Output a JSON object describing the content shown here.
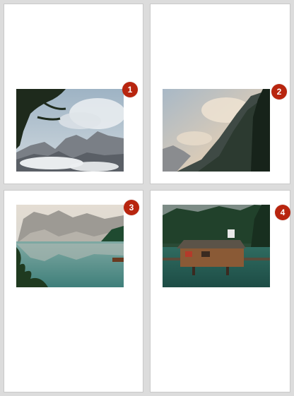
{
  "accent_color": "#b8250f",
  "pages": [
    {
      "badge": "1",
      "image": "misty-mountain-peaks-with-pine-branches"
    },
    {
      "badge": "2",
      "image": "mountain-ridge-at-sunrise-with-tree-silhouette"
    },
    {
      "badge": "3",
      "image": "alpine-lake-reflection-with-mountains"
    },
    {
      "badge": "4",
      "image": "wooden-boathouse-on-lake-with-forest"
    }
  ]
}
